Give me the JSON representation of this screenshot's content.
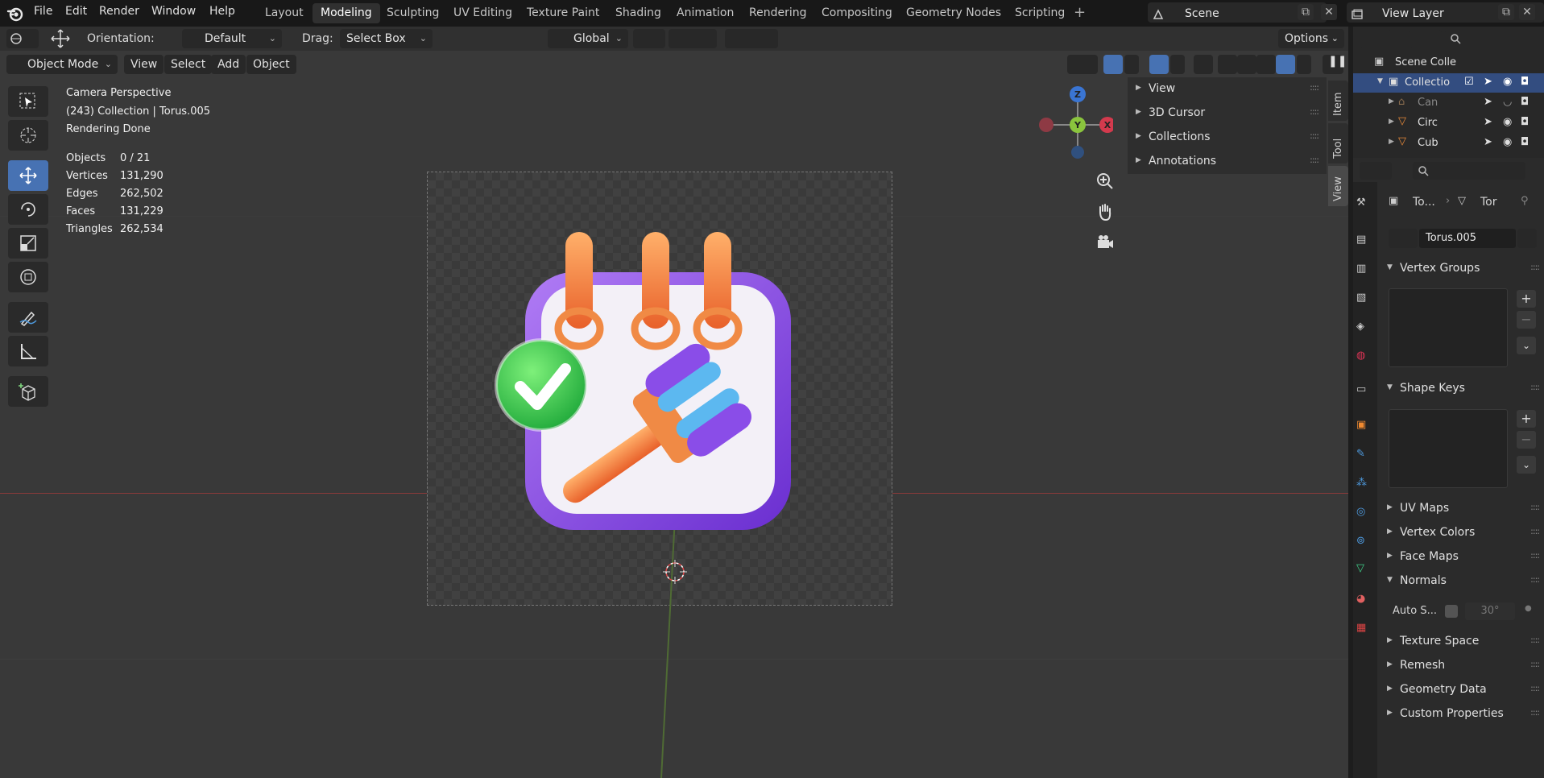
{
  "topbar": {
    "menus": [
      "File",
      "Edit",
      "Render",
      "Window",
      "Help"
    ],
    "workspaces": [
      "Layout",
      "Modeling",
      "Sculpting",
      "UV Editing",
      "Texture Paint",
      "Shading",
      "Animation",
      "Rendering",
      "Compositing",
      "Geometry Nodes",
      "Scripting"
    ],
    "active_workspace": "Modeling",
    "scene": "Scene",
    "view_layer": "View Layer"
  },
  "viewport_header": {
    "orientation_label": "Orientation:",
    "orientation_value": "Default",
    "drag_label": "Drag:",
    "drag_value": "Select Box",
    "transform_orientation": "Global",
    "options": "Options",
    "mode": "Object Mode",
    "menus": [
      "View",
      "Select",
      "Add",
      "Object"
    ]
  },
  "overlay_info": {
    "line1": "Camera Perspective",
    "line2": "(243) Collection | Torus.005",
    "line3": "Rendering Done",
    "stats": [
      {
        "label": "Objects",
        "value": "0 / 21"
      },
      {
        "label": "Vertices",
        "value": "131,290"
      },
      {
        "label": "Edges",
        "value": "262,502"
      },
      {
        "label": "Faces",
        "value": "131,229"
      },
      {
        "label": "Triangles",
        "value": "262,534"
      }
    ]
  },
  "gizmo": {
    "z": "Z",
    "y": "Y",
    "x": "X"
  },
  "npanel": {
    "sections": [
      "View",
      "3D Cursor",
      "Collections",
      "Annotations"
    ],
    "tabs": [
      "Item",
      "Tool",
      "View"
    ]
  },
  "outliner": {
    "root": "Scene Colle",
    "items": [
      "Collectio",
      "Can",
      "Circ",
      "Cub"
    ]
  },
  "properties": {
    "breadcrumb_object": "To...",
    "breadcrumb_data": "Tor",
    "mesh_name": "Torus.005",
    "panels": {
      "vertex_groups": "Vertex Groups",
      "shape_keys": "Shape Keys",
      "uv_maps": "UV Maps",
      "vertex_colors": "Vertex Colors",
      "face_maps": "Face Maps",
      "normals": "Normals",
      "auto_smooth": "Auto S...",
      "auto_smooth_angle": "30°",
      "texture_space": "Texture Space",
      "remesh": "Remesh",
      "geometry_data": "Geometry Data",
      "custom_properties": "Custom Properties"
    }
  },
  "colors": {
    "accent_blue": "#4772b3",
    "axis_red": "#d33a4d",
    "axis_green": "#8ac43d",
    "axis_blue": "#3a75d3",
    "icon_purple": "#8a4de8",
    "icon_orange": "#f07a35"
  }
}
